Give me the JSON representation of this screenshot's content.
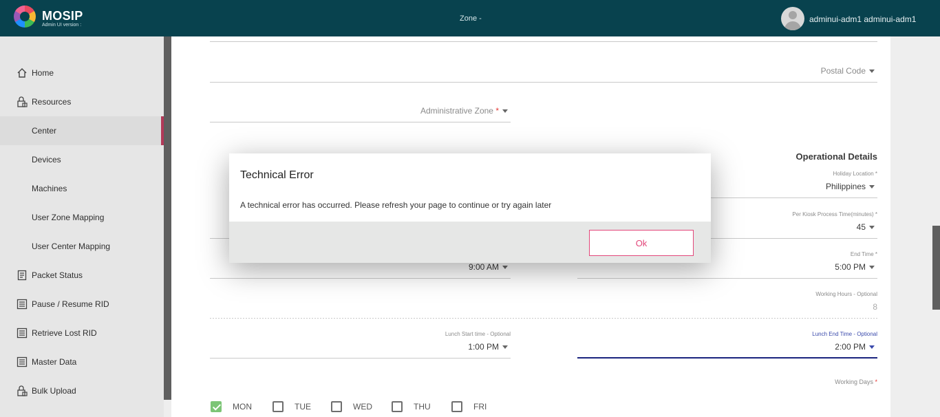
{
  "header": {
    "brand": "MOSIP",
    "brand_sub": "Admin UI version :",
    "zone": "Zone -",
    "user": "adminui-adm1 adminui-adm1"
  },
  "sidebar": {
    "items": [
      {
        "label": "Home",
        "icon": "home-icon"
      },
      {
        "label": "Resources",
        "icon": "lock-icon"
      },
      {
        "label": "Center",
        "active": true
      },
      {
        "label": "Devices"
      },
      {
        "label": "Machines"
      },
      {
        "label": "User Zone Mapping"
      },
      {
        "label": "User Center Mapping"
      },
      {
        "label": "Packet Status",
        "icon": "document-icon"
      },
      {
        "label": "Pause / Resume RID",
        "icon": "list-icon"
      },
      {
        "label": "Retrieve Lost RID",
        "icon": "list-icon"
      },
      {
        "label": "Master Data",
        "icon": "list-icon"
      },
      {
        "label": "Bulk Upload",
        "icon": "lock-icon"
      }
    ]
  },
  "form": {
    "postal_code": "Postal Code",
    "admin_zone": "Administrative Zone",
    "required_mark": "*",
    "operational_title": "Operational Details",
    "holiday_location_label": "Holiday Location *",
    "holiday_location_value": "Philippines",
    "per_kiosk_label": "Per Kiosk Process Time(minutes) *",
    "per_kiosk_value": "45",
    "end_time_label": "End Time *",
    "end_time_value": "5:00 PM",
    "start_time_value": "9:00 AM",
    "working_hours_label": "Working Hours - Optional",
    "working_hours_value": "8",
    "lunch_start_label": "Lunch Start time - Optional",
    "lunch_start_value": "1:00 PM",
    "lunch_end_label": "Lunch End Time - Optional",
    "lunch_end_value": "2:00 PM",
    "working_days_label": "Working Days",
    "days": [
      {
        "label": "MON",
        "checked": true
      },
      {
        "label": "TUE",
        "checked": false
      },
      {
        "label": "WED",
        "checked": false
      },
      {
        "label": "THU",
        "checked": false
      },
      {
        "label": "FRI",
        "checked": false
      }
    ]
  },
  "dialog": {
    "title": "Technical Error",
    "message": "A technical error has occurred. Please refresh your page to continue or try again later",
    "ok_label": "Ok"
  },
  "colors": {
    "header_bg": "#08424e",
    "accent": "#e2467a",
    "active_indicator": "#b23958",
    "focus_underline": "#1a237e"
  }
}
